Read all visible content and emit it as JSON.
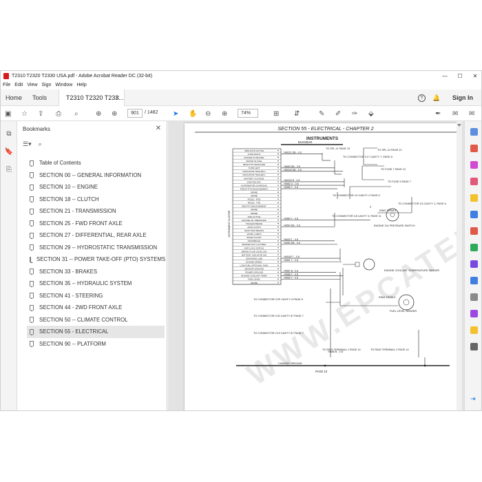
{
  "window": {
    "title": "T2310 T2320 T2330 USA.pdf - Adobe Acrobat Reader DC (32-bit)",
    "minimize": "—",
    "maximize": "☐",
    "close": "✕"
  },
  "menu": [
    "File",
    "Edit",
    "View",
    "Sign",
    "Window",
    "Help"
  ],
  "tabs": {
    "home": "Home",
    "tools": "Tools",
    "document": "T2310 T2320 T233...",
    "help": "?",
    "sign_in": "Sign In"
  },
  "toolbar": {
    "page_number": "901",
    "page_total": "/ 1482",
    "zoom": "74%"
  },
  "bookmarks": {
    "heading": "Bookmarks",
    "items": [
      "Table of Contents",
      "SECTION 00 -- GENERAL INFORMATION",
      "SECTION 10 -- ENGINE",
      "SECTION 18 -- CLUTCH",
      "SECTION 21 - TRANSMISSION",
      "SECTION 25 - FWD FRONT AXLE",
      "SECTION 27 - DIFFERENTIAL, REAR AXLE",
      "SECTION 29 -- HYDROSTATIC TRANSMISSION",
      "SECTION 31 -- POWER TAKE-OFF (PTO) SYSTEMS",
      "SECTION 33 - BRAKES",
      "SECTION 35 -- HYDRAULIC SYSTEM",
      "SECTION 41 - STEERING",
      "SECTION 44 - 2WD FRONT AXLE",
      "SECTION 50 -- CLIMATE CONTROL",
      "SECTION 55 - ELECTRICAL",
      "SECTION 90 -- PLATFORM"
    ],
    "selected_index": 14
  },
  "page": {
    "header": "SECTION 55 - ELECTRICAL - CHAPTER 2",
    "instruments": "INSTRUMENTS",
    "busbar": "BUSSBAR",
    "chassis_ground": "CHASSIS GROUND",
    "footer": "PAGE 10",
    "watermark": "WWW.EPCATEPO.COM",
    "wire_labels": [
      "HM101  DB - 0.8",
      "HM89  DB - 0.8",
      "HM100  DB - 0.8",
      "HM153  R - 0.8",
      "HM82  O - 0.8",
      "HM85  Y - 0.8",
      "HM84  Y - 0.8",
      "HM54  DB - 0.8",
      "HM25  T - 0.8",
      "HM90  DB - 0.8",
      "HM180  T - 0.8",
      "HM81  Y - 0.8",
      "HM87  B - 0.8",
      "HM88  Y - 0.8",
      "HM83  Y - 0.8",
      "HD89  Y - 0.8"
    ],
    "connectors": [
      "TO SPL-11 PAGE 13",
      "TO CONNECTOR C17 CAVITY 7, PAGE 8",
      "TO SPL-10 PAGE 12",
      "TO FUSE 7 PAGE 12",
      "TO FUSE 5 PAGE 7",
      "TO CONNECTOR C4 CAVITY 2 PAGE 6",
      "TO CONNECTOR C5 CAVITY 1, PAGE 6",
      "RING TERM 8",
      "ENGINE OIL PRESSURE SWITCH",
      "TO CONNECTOR C8 CAVITY 3, PAGE 11",
      "ENGINE COOLANT TEMPERATURE SENDER",
      "RING TERM 9",
      "FUEL LEVEL SENDER",
      "TO CONNECTOR C2P CAVITY H PAGE 8",
      "TO CONNECTOR C20 CAVITY 87 PAGE 7",
      "TO CONNECTOR C19 CAVITY 87 PAGE 7",
      "TO RING TERMINAL 1 PAGE 14",
      "TO RING TERMINAL 2 PAGE 14",
      "HD88  B - 0.8"
    ],
    "cluster_rows": [
      "4WD AUTO ACTIVE",
      "TURN RIGHT",
      "ENGINE IN HEATER",
      "WATER IN FUEL",
      "REAR PTO ENGAGED",
      "TURN LEFT",
      "INDICATOR TRAILER 2",
      "INDICATOR TRAILER 1",
      "BATTERY VOLTAGE",
      "IGNITION KEY",
      "ALTERNATOR CHARGING",
      "FRONT PTO ENGAGEMENT",
      "SPARE",
      "SPARE",
      "RS232 - RXD",
      "RS232 - TXD",
      "MID PTO ENGAGEMENT",
      "SPARE",
      "SPARE",
      "4WD ACTIVE",
      "ENGINE OIL PRESSURE",
      "TRAILER BRAKE",
      "20SS LIGHTS",
      "MAIN HIGH BEAMS",
      "WORK LAMPS",
      "BOOM FLOOD",
      "PARKBRAKE",
      "BRAKES NOT LATCHED",
      "DIFF LOCK STATUS",
      "BRAKE FLUID LEVEL SW",
      "BATTERY ISOLATOR SW",
      "CRANKING LINE",
      "ENGINE SPEED",
      "LOW FUEL OPTIONAL TANK",
      "SENSOR GROUND",
      "POWER GROUND",
      "ENGINE COOLANT TEMP",
      "FUEL LEVEL",
      "SPARE"
    ],
    "cluster_label": "INSTRUMENT CLUSTER"
  }
}
